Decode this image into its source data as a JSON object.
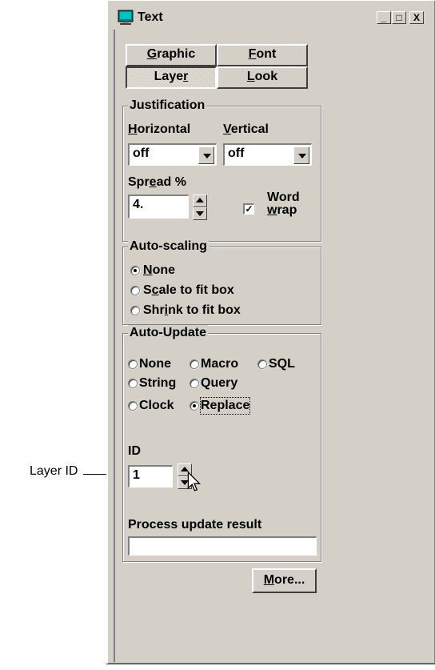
{
  "window": {
    "title": "Text",
    "minimize": "_",
    "maximize": "□",
    "close": "X"
  },
  "tabs": [
    {
      "label_u": "G",
      "label_rest": "raphic"
    },
    {
      "label_u": "F",
      "label_rest": "ont"
    },
    {
      "label_pre": "Laye",
      "label_u": "r",
      "label_rest": ""
    },
    {
      "label_u": "L",
      "label_rest": "ook"
    }
  ],
  "justification": {
    "legend": "Justification",
    "horizontal": {
      "u": "H",
      "rest": "orizontal"
    },
    "vertical": {
      "u": "V",
      "rest": "ertical"
    },
    "horizontal_value": "off",
    "vertical_value": "off",
    "spread": {
      "pre": "Spr",
      "u": "e",
      "rest": "ad %"
    },
    "spread_value": "4.",
    "word_wrap_checked": true,
    "word": "Word",
    "wrap": {
      "u": "w",
      "rest": "rap"
    }
  },
  "autoscaling": {
    "legend": "Auto-scaling",
    "options": [
      {
        "pre": "",
        "u": "N",
        "rest": "one",
        "selected": true
      },
      {
        "pre": "S",
        "u": "c",
        "rest": "ale to fit box",
        "selected": false
      },
      {
        "pre": "Shr",
        "u": "i",
        "rest": "nk to fit box",
        "selected": false
      }
    ]
  },
  "autoupdate": {
    "legend": "Auto-Update",
    "options": [
      {
        "label": "None",
        "selected": false
      },
      {
        "label": "Macro",
        "selected": false
      },
      {
        "label": "SQL",
        "selected": false
      },
      {
        "label": "String",
        "selected": false
      },
      {
        "label": "Query",
        "selected": false
      },
      {
        "label": "Clock",
        "selected": false
      },
      {
        "label": "Replace",
        "selected": true
      }
    ],
    "id_label": "ID",
    "id_value": "1",
    "process_label": "Process update result",
    "process_value": ""
  },
  "more_button": {
    "u": "M",
    "rest": "ore..."
  },
  "callout": {
    "label": "Layer ID"
  }
}
